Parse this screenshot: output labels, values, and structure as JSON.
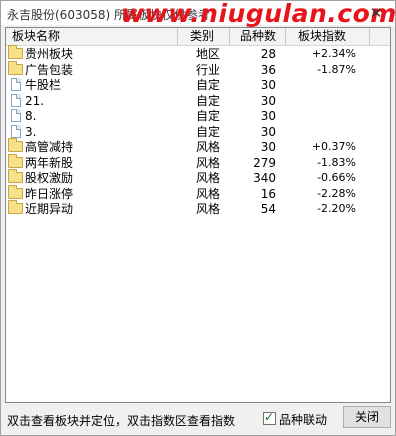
{
  "window": {
    "title": "永吉股份(603058)  所属板块仅供参考",
    "watermark": "www.niugulan.com",
    "close_glyph": "✕"
  },
  "table": {
    "headers": [
      "板块名称",
      "类别",
      "品种数",
      "板块指数"
    ],
    "rows": [
      {
        "icon": "folder-icon",
        "name": "贵州板块",
        "type": "地区",
        "count": "28",
        "index": "+2.34%"
      },
      {
        "icon": "folder-icon",
        "name": "广告包装",
        "type": "行业",
        "count": "36",
        "index": "-1.87%"
      },
      {
        "icon": "document-icon",
        "name": "牛股栏",
        "type": "自定",
        "count": "30",
        "index": ""
      },
      {
        "icon": "document-icon",
        "name": "21.",
        "type": "自定",
        "count": "30",
        "index": ""
      },
      {
        "icon": "document-icon",
        "name": "8.",
        "type": "自定",
        "count": "30",
        "index": ""
      },
      {
        "icon": "document-icon",
        "name": "3.",
        "type": "自定",
        "count": "30",
        "index": ""
      },
      {
        "icon": "folder-icon",
        "name": "高管减持",
        "type": "风格",
        "count": "30",
        "index": "+0.37%"
      },
      {
        "icon": "folder-icon",
        "name": "两年新股",
        "type": "风格",
        "count": "279",
        "index": "-1.83%"
      },
      {
        "icon": "folder-icon",
        "name": "股权激励",
        "type": "风格",
        "count": "340",
        "index": "-0.66%"
      },
      {
        "icon": "folder-icon",
        "name": "昨日涨停",
        "type": "风格",
        "count": "16",
        "index": "-2.28%"
      },
      {
        "icon": "folder-icon",
        "name": "近期异动",
        "type": "风格",
        "count": "54",
        "index": "-2.20%"
      }
    ]
  },
  "footer": {
    "hint": "双击查看板块并定位，双击指数区查看指数",
    "checkbox_label": "品种联动",
    "checkbox_checked": true,
    "close_label": "关闭"
  },
  "colors": {
    "watermark": "#e8141c",
    "folder": "#f7e08a",
    "window_bg": "#f0f0f0"
  }
}
